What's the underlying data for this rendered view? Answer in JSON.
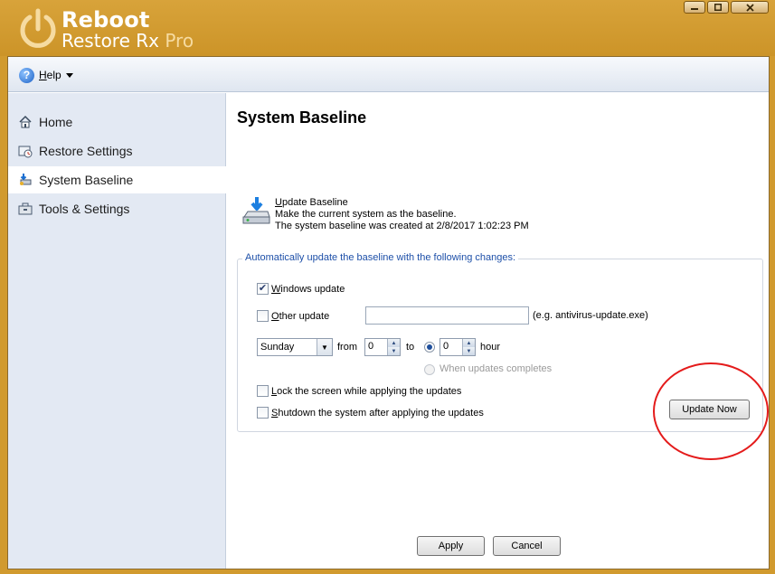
{
  "app": {
    "name_line1": "Reboot",
    "name_line2": "Restore Rx",
    "name_suffix": "Pro"
  },
  "menu": {
    "help_label": "Help"
  },
  "sidebar": {
    "items": [
      {
        "label": "Home",
        "icon": "home-icon"
      },
      {
        "label": "Restore Settings",
        "icon": "restore-settings-icon"
      },
      {
        "label": "System Baseline",
        "icon": "system-baseline-icon",
        "active": true
      },
      {
        "label": "Tools & Settings",
        "icon": "tools-icon"
      }
    ]
  },
  "main": {
    "title": "System Baseline",
    "update_baseline": {
      "heading": "Update Baseline",
      "description": "Make the current system as the baseline.",
      "created": "The system baseline was created at 2/8/2017 1:02:23 PM"
    },
    "auto_group": {
      "legend": "Automatically update the baseline with the following changes:",
      "windows_update": {
        "label": "Windows update",
        "checked": true
      },
      "other_update": {
        "label": "Other update",
        "checked": false,
        "value": "",
        "hint": "(e.g. antivirus-update.exe)"
      },
      "schedule": {
        "day": "Sunday",
        "from_label": "from",
        "from_value": "0",
        "to_label": "to",
        "to_value": "0",
        "hour_label": "hour",
        "when_complete_label": "When updates completes"
      },
      "lock_screen": {
        "label": "Lock the screen while applying the updates",
        "checked": false
      },
      "shutdown": {
        "label": "Shutdown the system after applying the updates",
        "checked": false
      },
      "update_now_label": "Update Now"
    },
    "apply_label": "Apply",
    "cancel_label": "Cancel"
  },
  "colors": {
    "title_bar": "#d19a2e",
    "sidebar_bg": "#e3e9f3",
    "group_legend": "#1d4fa8",
    "annotation": "#e41b1b"
  }
}
